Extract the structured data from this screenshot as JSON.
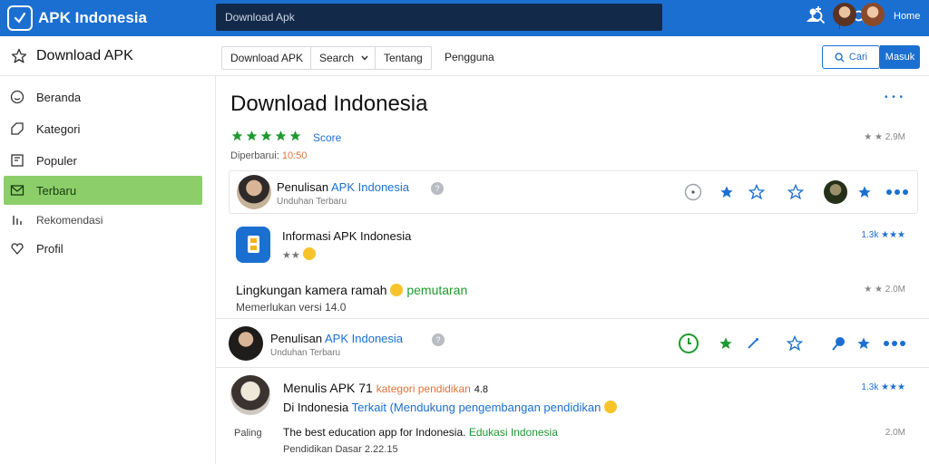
{
  "app": {
    "brand": "APK Indonesia",
    "search_placeholder": "Download Apk",
    "user_name": "Home"
  },
  "toolbar": {
    "title": "Download APK",
    "tabs": [
      "Download APK",
      "Search",
      "Tentang",
      "Pengguna"
    ],
    "search_button": "Cari",
    "login_button": "Masuk"
  },
  "sidebar": {
    "items": [
      {
        "label": "Beranda",
        "icon": "smile-icon"
      },
      {
        "label": "Kategori",
        "icon": "tag-icon"
      },
      {
        "label": "Populer",
        "icon": "bookmark-icon"
      },
      {
        "label": "Terbaru",
        "icon": "mail-icon",
        "active": true
      },
      {
        "label": "Rekomendasi",
        "icon": "bars-icon"
      },
      {
        "label": "Profil",
        "icon": "heart-icon"
      }
    ]
  },
  "main": {
    "title": "Download Indonesia",
    "corner_dots": "• • •",
    "rating_label": "Score",
    "rating_stars": 5,
    "size": "2.9M",
    "updated_prefix": "Diperbarui:",
    "updated_value": "10:50",
    "row1": {
      "title": "Penulisan",
      "title_blue": "APK Indonesia",
      "sub": "Unduhan Terbaru"
    },
    "section2": {
      "title": "Informasi APK Indonesia",
      "rating_tag": "★★",
      "count": "1.3k ★★★",
      "body": "Lingkungan kamera ramah",
      "body_green": "pemutaran",
      "sub": "Memerlukan versi 14.0",
      "size": "2.0M"
    },
    "row2": {
      "title": "Penulisan",
      "title_blue": "APK Indonesia",
      "sub": "Unduhan Terbaru"
    },
    "section4": {
      "title": "Menulis APK",
      "title_num": "71",
      "title_orange": "kategori pendidikan",
      "title_tail": "4.8",
      "count": "1.3k ★★★",
      "line2": "Di Indonesia",
      "line2_blue": "Terkait (Mendukung pengembangan pendidikan",
      "left_label": "Paling",
      "body": "The best education app for Indonesia.",
      "body_green": "Edukasi Indonesia",
      "sub": "Pendidikan Dasar 2.22.15",
      "size": "2.0M"
    }
  },
  "colors": {
    "brand_blue": "#1b6fd1",
    "search_bg": "#12294a",
    "active_green": "#8cce6a",
    "star_green": "#1f9a2f"
  }
}
